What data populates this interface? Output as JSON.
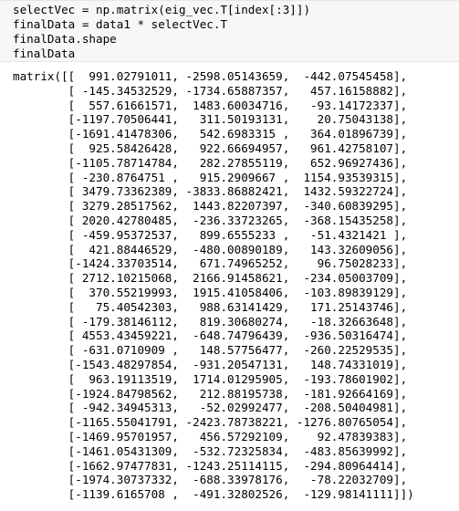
{
  "input_cell": {
    "lines": [
      "selectVec = np.matrix(eig_vec.T[index[:3]])",
      "finalData = data1 * selectVec.T",
      "finalData.shape",
      "finalData"
    ]
  },
  "output_cell": {
    "lines": [
      "matrix([[  991.02791011, -2598.05143659,  -442.07545458],",
      "        [ -145.34532529, -1734.65887357,   457.16158882],",
      "        [  557.61661571,  1483.60034716,   -93.14172337],",
      "        [-1197.70506441,   311.50193131,    20.75043138],",
      "        [-1691.41478306,   542.6983315 ,   364.01896739],",
      "        [  925.58426428,   922.66694957,   961.42758107],",
      "        [-1105.78714784,   282.27855119,   652.96927436],",
      "        [ -230.8764751 ,   915.2909667 ,  1154.93539315],",
      "        [ 3479.73362389, -3833.86882421,  1432.59322724],",
      "        [ 3279.28517562,  1443.82207397,  -340.60839295],",
      "        [ 2020.42780485,  -236.33723265,  -368.15435258],",
      "        [ -459.95372537,   899.6555233 ,   -51.4321421 ],",
      "        [  421.88446529,  -480.00890189,   143.32609056],",
      "        [-1424.33703514,   671.74965252,    96.75028233],",
      "        [ 2712.10215068,  2166.91458621,  -234.05003709],",
      "        [  370.55219993,  1915.41058406,  -103.89839129],",
      "        [   75.40542303,   988.63141429,   171.25143746],",
      "        [ -179.38146112,   819.30680274,   -18.32663648],",
      "        [ 4553.43459221,  -648.74796439,  -936.50316474],",
      "        [ -631.0710909 ,   148.57756477,  -260.22529535],",
      "        [-1543.48297854,  -931.20547131,   148.74331019],",
      "        [  963.19113519,  1714.01295905,  -193.78601902],",
      "        [-1924.84798562,   212.88195738,  -181.92664169],",
      "        [ -942.34945313,   -52.02992477,  -208.50404981],",
      "        [-1165.55041791, -2423.78738221, -1276.80765054],",
      "        [-1469.95701957,   456.57292109,    92.47839383],",
      "        [-1461.05431309,  -532.72325834,  -483.85639992],",
      "        [-1662.97477831, -1243.25114115,  -294.80964414],",
      "        [-1974.30737332,  -688.33978176,   -78.22032709],",
      "        [-1139.6165708 ,  -491.32802526,  -129.98141111]])"
    ]
  }
}
